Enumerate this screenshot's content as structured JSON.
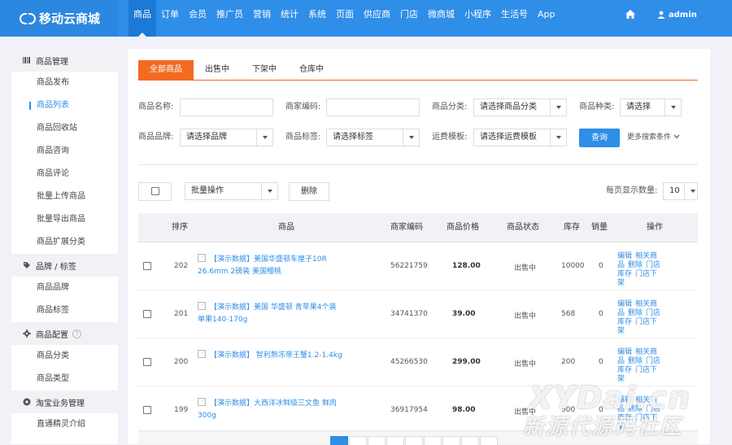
{
  "app": {
    "logo_text": "移动云商城",
    "user": "admin",
    "colors": {
      "primary": "#2f8ee8",
      "accent": "#f26b21"
    }
  },
  "nav": [
    "商品",
    "订单",
    "会员",
    "推广员",
    "营销",
    "统计",
    "系统",
    "页面",
    "供应商",
    "门店",
    "微商城",
    "小程序",
    "生活号",
    "App"
  ],
  "sidebar": {
    "groups": [
      {
        "title": "商品管理",
        "icon": "barcode-icon",
        "items": [
          "商品发布",
          "商品列表",
          "商品回收站",
          "商品咨询",
          "商品评论",
          "批量上传商品",
          "批量导出商品",
          "商品扩展分类"
        ]
      },
      {
        "title": "品牌 / 标签",
        "icon": "tag-icon",
        "items": [
          "商品品牌",
          "商品标签"
        ]
      },
      {
        "title": "商品配置",
        "icon": "gear-icon",
        "items": [
          "商品分类",
          "商品类型"
        ]
      },
      {
        "title": "淘宝业务管理",
        "icon": "taobao-icon",
        "items": [
          "直通精灵介绍"
        ]
      }
    ],
    "active_item": "商品列表"
  },
  "tabs": [
    "全部商品",
    "出售中",
    "下架中",
    "仓库中"
  ],
  "filters": {
    "name_label": "商品名称:",
    "code_label": "商家编码:",
    "category_label": "商品分类:",
    "category_value": "请选择商品分类",
    "kind_label": "商品种类:",
    "kind_value": "请选择",
    "brand_label": "商品品牌:",
    "brand_value": "请选择品牌",
    "tag_label": "商品标签:",
    "tag_value": "请选择标签",
    "freight_label": "运费模板:",
    "freight_value": "请选择运费模板",
    "query_button": "查询",
    "more_conditions": "更多搜索条件"
  },
  "bulk": {
    "operation_select": "批量操作",
    "delete_button": "删除",
    "page_size_label": "每页显示数量:",
    "page_size_value": "10"
  },
  "table": {
    "headers": [
      "排序",
      "商品",
      "商家编码",
      "商品价格",
      "商品状态",
      "库存",
      "销量",
      "操作"
    ],
    "rows": [
      {
        "sort": "202",
        "name": "【演示数据】美国华盛顿车厘子10R 26.6mm 2磅装 美国樱桃",
        "code": "56221759",
        "price": "128.00",
        "status": "出售中",
        "stock": "10000",
        "sales": "0"
      },
      {
        "sort": "201",
        "name": "【演示数据】美国 华盛顿 青苹果4个装 单果140-170g",
        "code": "34741370",
        "price": "39.00",
        "status": "出售中",
        "stock": "568",
        "sales": "0"
      },
      {
        "sort": "200",
        "name": "【演示数据】 智利熟冻帝王蟹1.2-1.4kg",
        "code": "45266530",
        "price": "299.00",
        "status": "出售中",
        "stock": "200",
        "sales": "0"
      },
      {
        "sort": "199",
        "name": "【演示数据】大西洋冰鲜级三文鱼 鲜肉300g",
        "code": "36917954",
        "price": "98.00",
        "status": "出售中",
        "stock": "500",
        "sales": "0"
      }
    ],
    "ops": [
      "编辑",
      "相关商品",
      "删除",
      "门店库存",
      "门店下架"
    ]
  },
  "watermark": {
    "line1": "XYDai.cn",
    "line2": "新源代源码社区"
  }
}
